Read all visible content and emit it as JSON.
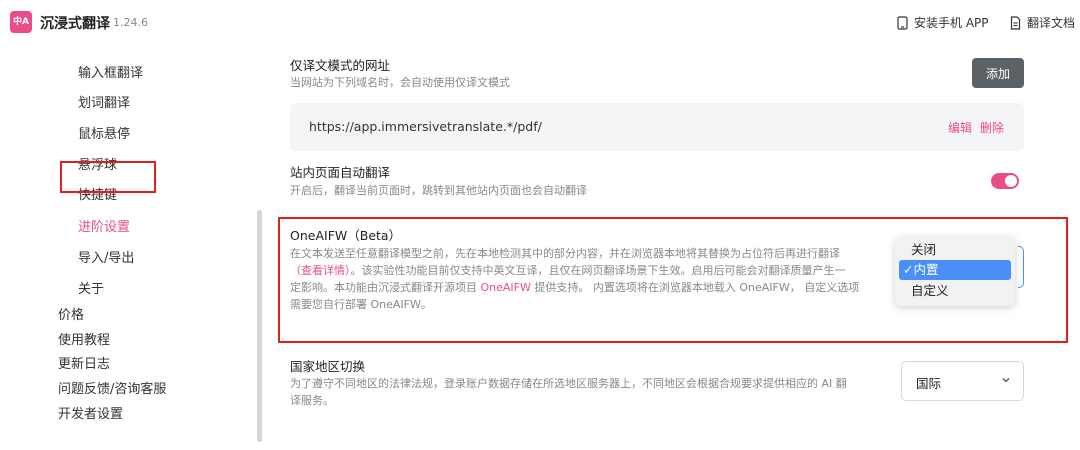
{
  "header": {
    "logo_text": "中A",
    "app_name": "沉浸式翻译",
    "version": "1.24.6",
    "links": [
      "安装手机 APP",
      "翻译文档"
    ]
  },
  "sidebar": {
    "sub_items": [
      "输入框翻译",
      "划词翻译",
      "鼠标悬停",
      "悬浮球",
      "快捷键",
      "进阶设置",
      "导入/导出",
      "关于"
    ],
    "active": "进阶设置",
    "top_items": [
      "价格",
      "使用教程",
      "更新日志",
      "问题反馈/咨询客服",
      "开发者设置"
    ]
  },
  "sections": {
    "translate_only": {
      "title": "仅译文模式的网址",
      "desc": "当网站为下列域名时，会自动使用仅译文模式",
      "add_label": "添加",
      "url": "https://app.immersivetranslate.*/pdf/",
      "edit_label": "编辑",
      "delete_label": "删除"
    },
    "auto_translate": {
      "title": "站内页面自动翻译",
      "desc": "开启后，翻译当前页面时，跳转到其他站内页面也会自动翻译",
      "enabled": true
    },
    "oneaifw": {
      "title": "OneAIFW（Beta）",
      "desc_line1": "在文本发送至任意翻译模型之前，先在本地检测其中的部分内容，并在浏览器本地将其替换为占位符后再进行翻译",
      "desc_link1": "（查看详情）",
      "desc_line2_rest": "。该实验性功能目前仅支持中英文互译，且仅在网页翻译场景下生效。启用后可能会对翻译质量产生一",
      "desc_line3_pre": "定影响。本功能由沉浸式翻译开源项目 ",
      "desc_link2": "OneAIFW",
      "desc_line3_post": " 提供支持。 内置选项将在浏览器本地载入 OneAIFW， 自定义选项",
      "desc_line4": "需要您自行部署 OneAIFW。",
      "options": [
        "关闭",
        "内置",
        "自定义"
      ],
      "selected": "内置",
      "check_mark": "✓"
    },
    "region": {
      "title": "国家地区切换",
      "desc_line1": "为了遵守不同地区的法律法规，登录账户数据存储在所选地区服务器上，不同地区会根据合规要求提供相应的 AI 翻",
      "desc_line2": "译服务。",
      "value": "国际"
    }
  },
  "colors": {
    "accent": "#ea4c89",
    "highlight_border": "#e02020",
    "button_dark": "#5c6166",
    "select_blue": "#4a8ff7"
  }
}
